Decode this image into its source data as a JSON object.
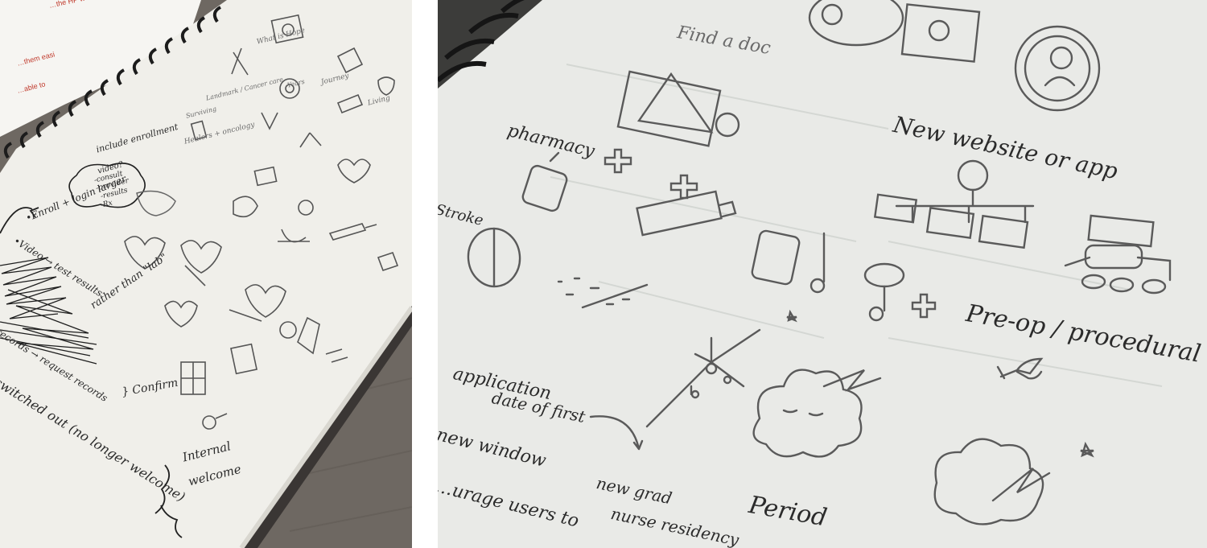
{
  "left_photo": {
    "annotations": {
      "what_is_hope": "What is Hope",
      "journey": "Journey",
      "landmark": "Landmark / Cancer care",
      "years": "Years",
      "living": "Living",
      "surviving": "Surviving",
      "healers": "Healers + oncology",
      "include_enrollment": "include enrollment",
      "video": "video?",
      "bubble_lines": [
        "-consult",
        "-provider",
        "-results",
        "-Rx"
      ],
      "enroll": "•Enroll + login larger",
      "video_test": "•Video → test results",
      "rather_lab": "rather than \"lab\"",
      "records": "records → request records",
      "confirm": "} Confirm",
      "switched_out": "switched out (no longer welcome)",
      "internal_welcome": [
        "Internal",
        "welcome"
      ]
    },
    "printed_text": [
      "…the HP world when looking",
      "…them easi",
      "…able to"
    ]
  },
  "right_photo": {
    "annotations": {
      "find_a_doc": "Find a doc",
      "pharmacy": "pharmacy",
      "new_website": "New website or app",
      "stroke": "Stroke",
      "pre_op": "Pre-op / procedural",
      "application": "application",
      "date_of_first": "date of first",
      "new_window": "new window",
      "new_grad": "new grad",
      "nurse_residency": "nurse residency",
      "period": "Period",
      "encourage": "…urage users to"
    }
  },
  "colors": {
    "paper": "#f1f0ec",
    "paper_right": "#e9eae7",
    "pencil": "#555555",
    "ink": "#222222",
    "table": "#6e6862",
    "printed_red": "#c0392b"
  }
}
